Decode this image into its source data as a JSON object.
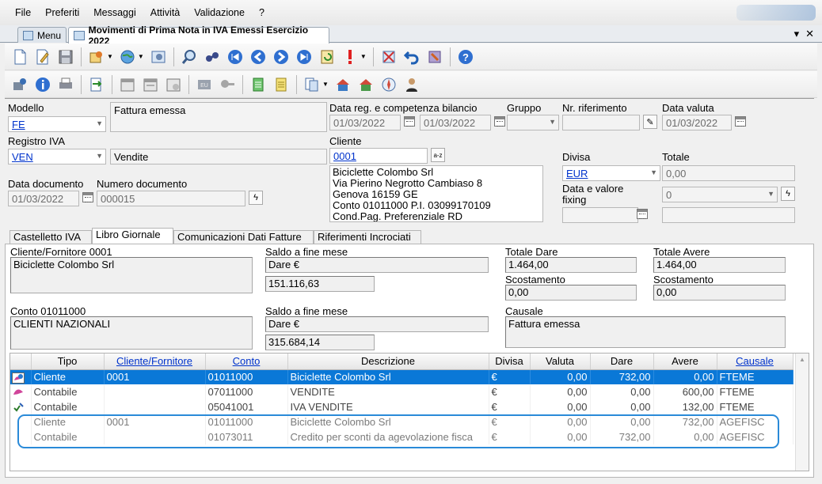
{
  "menu": [
    "File",
    "Preferiti",
    "Messaggi",
    "Attività",
    "Validazione",
    "?"
  ],
  "window_tabs": [
    {
      "label": "Menu"
    },
    {
      "label": "Movimenti di Prima Nota in IVA Emessi Esercizio 2022",
      "active": true
    }
  ],
  "window_controls": {
    "dropdown": "▾",
    "close": "✕"
  },
  "form": {
    "modello_label": "Modello",
    "modello_value": "FE",
    "modello_desc": "Fattura emessa",
    "data_reg_label": "Data reg. e competenza bilancio",
    "data_reg_value": "01/03/2022",
    "data_comp_value": "01/03/2022",
    "gruppo_label": "Gruppo",
    "nr_rif_label": "Nr. riferimento",
    "data_valuta_label": "Data valuta",
    "data_valuta_value": "01/03/2022",
    "registro_label": "Registro IVA",
    "registro_value": "VEN",
    "registro_desc": "Vendite",
    "cliente_label": "Cliente",
    "cliente_code": "0001",
    "cliente_address": "Biciclette Colombo Srl\nVia Pierino Negrotto Cambiaso 8\nGenova 16159 GE\nConto 01011000 P.I. 03099170109\nCond.Pag. Preferenziale RD",
    "divisa_label": "Divisa",
    "divisa_value": "EUR",
    "totale_label": "Totale",
    "totale_value": "0,00",
    "fixing_label": "Data e valore\nfixing",
    "fixing_value": "0",
    "data_doc_label": "Data documento",
    "data_doc_value": "01/03/2022",
    "num_doc_label": "Numero documento",
    "num_doc_value": "000015"
  },
  "bottom_tabs": [
    "Castelletto IVA",
    "Libro Giornale",
    "Comunicazioni Dati Fatture",
    "Riferimenti Incrociati"
  ],
  "summary": {
    "cliente_label": "Cliente/Fornitore 0001",
    "cliente_value": "Biciclette Colombo Srl",
    "saldo1_label": "Saldo a fine mese",
    "saldo1_side": "Dare €",
    "saldo1_value": "151.116,63",
    "totale_dare_label": "Totale Dare",
    "totale_dare_value": "1.464,00",
    "totale_avere_label": "Totale Avere",
    "totale_avere_value": "1.464,00",
    "scost1_label": "Scostamento",
    "scost1_value": "0,00",
    "scost2_label": "Scostamento",
    "scost2_value": "0,00",
    "conto_label": "Conto 01011000",
    "conto_value": "CLIENTI NAZIONALI",
    "saldo2_label": "Saldo a fine mese",
    "saldo2_side": "Dare €",
    "saldo2_value": "315.684,14",
    "causale_label": "Causale",
    "causale_value": "Fattura emessa"
  },
  "grid": {
    "columns": [
      "Tipo",
      "Cliente/Fornitore",
      "Conto",
      "Descrizione",
      "Divisa",
      "Valuta",
      "Dare",
      "Avere",
      "Causale"
    ],
    "rows": [
      {
        "tipo": "Cliente",
        "cf": "0001",
        "conto": "01011000",
        "desc": "Biciclette Colombo Srl",
        "divisa": "€",
        "valuta": "0,00",
        "dare": "732,00",
        "avere": "0,00",
        "causale": "FTEME",
        "state": "sel",
        "icon": "customer-icon"
      },
      {
        "tipo": "Contabile",
        "cf": "",
        "conto": "07011000",
        "desc": "VENDITE",
        "divisa": "€",
        "valuta": "0,00",
        "dare": "0,00",
        "avere": "600,00",
        "causale": "FTEME",
        "state": "normal",
        "icon": "account-icon"
      },
      {
        "tipo": "Contabile",
        "cf": "",
        "conto": "05041001",
        "desc": "IVA VENDITE",
        "divisa": "€",
        "valuta": "0,00",
        "dare": "0,00",
        "avere": "132,00",
        "causale": "FTEME",
        "state": "normal",
        "icon": "vat-icon"
      },
      {
        "tipo": "Cliente",
        "cf": "0001",
        "conto": "01011000",
        "desc": "Biciclette Colombo Srl",
        "divisa": "€",
        "valuta": "0,00",
        "dare": "0,00",
        "avere": "732,00",
        "causale": "AGEFISC",
        "state": "dim",
        "icon": ""
      },
      {
        "tipo": "Contabile",
        "cf": "",
        "conto": "01073011",
        "desc": "Credito per sconti da agevolazione fisca",
        "divisa": "€",
        "valuta": "0,00",
        "dare": "732,00",
        "avere": "0,00",
        "causale": "AGEFISC",
        "state": "dim",
        "icon": ""
      }
    ]
  },
  "colors": {
    "accent": "#0a78d7",
    "highlight": "#2a8ad8",
    "link": "#0033cc"
  }
}
